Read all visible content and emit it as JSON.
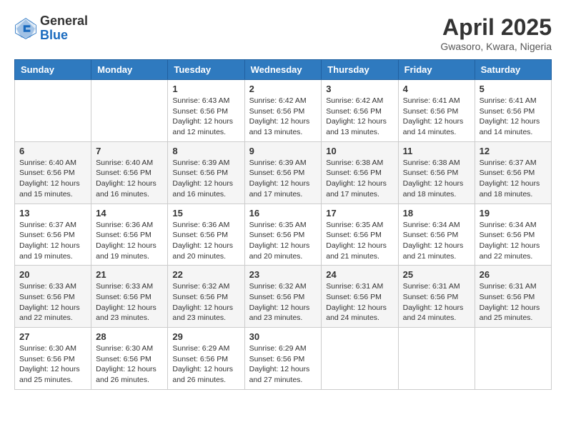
{
  "logo": {
    "general": "General",
    "blue": "Blue"
  },
  "header": {
    "title": "April 2025",
    "subtitle": "Gwasoro, Kwara, Nigeria"
  },
  "weekdays": [
    "Sunday",
    "Monday",
    "Tuesday",
    "Wednesday",
    "Thursday",
    "Friday",
    "Saturday"
  ],
  "weeks": [
    [
      {
        "day": "",
        "sunrise": "",
        "sunset": "",
        "daylight": ""
      },
      {
        "day": "",
        "sunrise": "",
        "sunset": "",
        "daylight": ""
      },
      {
        "day": "1",
        "sunrise": "Sunrise: 6:43 AM",
        "sunset": "Sunset: 6:56 PM",
        "daylight": "Daylight: 12 hours and 12 minutes."
      },
      {
        "day": "2",
        "sunrise": "Sunrise: 6:42 AM",
        "sunset": "Sunset: 6:56 PM",
        "daylight": "Daylight: 12 hours and 13 minutes."
      },
      {
        "day": "3",
        "sunrise": "Sunrise: 6:42 AM",
        "sunset": "Sunset: 6:56 PM",
        "daylight": "Daylight: 12 hours and 13 minutes."
      },
      {
        "day": "4",
        "sunrise": "Sunrise: 6:41 AM",
        "sunset": "Sunset: 6:56 PM",
        "daylight": "Daylight: 12 hours and 14 minutes."
      },
      {
        "day": "5",
        "sunrise": "Sunrise: 6:41 AM",
        "sunset": "Sunset: 6:56 PM",
        "daylight": "Daylight: 12 hours and 14 minutes."
      }
    ],
    [
      {
        "day": "6",
        "sunrise": "Sunrise: 6:40 AM",
        "sunset": "Sunset: 6:56 PM",
        "daylight": "Daylight: 12 hours and 15 minutes."
      },
      {
        "day": "7",
        "sunrise": "Sunrise: 6:40 AM",
        "sunset": "Sunset: 6:56 PM",
        "daylight": "Daylight: 12 hours and 16 minutes."
      },
      {
        "day": "8",
        "sunrise": "Sunrise: 6:39 AM",
        "sunset": "Sunset: 6:56 PM",
        "daylight": "Daylight: 12 hours and 16 minutes."
      },
      {
        "day": "9",
        "sunrise": "Sunrise: 6:39 AM",
        "sunset": "Sunset: 6:56 PM",
        "daylight": "Daylight: 12 hours and 17 minutes."
      },
      {
        "day": "10",
        "sunrise": "Sunrise: 6:38 AM",
        "sunset": "Sunset: 6:56 PM",
        "daylight": "Daylight: 12 hours and 17 minutes."
      },
      {
        "day": "11",
        "sunrise": "Sunrise: 6:38 AM",
        "sunset": "Sunset: 6:56 PM",
        "daylight": "Daylight: 12 hours and 18 minutes."
      },
      {
        "day": "12",
        "sunrise": "Sunrise: 6:37 AM",
        "sunset": "Sunset: 6:56 PM",
        "daylight": "Daylight: 12 hours and 18 minutes."
      }
    ],
    [
      {
        "day": "13",
        "sunrise": "Sunrise: 6:37 AM",
        "sunset": "Sunset: 6:56 PM",
        "daylight": "Daylight: 12 hours and 19 minutes."
      },
      {
        "day": "14",
        "sunrise": "Sunrise: 6:36 AM",
        "sunset": "Sunset: 6:56 PM",
        "daylight": "Daylight: 12 hours and 19 minutes."
      },
      {
        "day": "15",
        "sunrise": "Sunrise: 6:36 AM",
        "sunset": "Sunset: 6:56 PM",
        "daylight": "Daylight: 12 hours and 20 minutes."
      },
      {
        "day": "16",
        "sunrise": "Sunrise: 6:35 AM",
        "sunset": "Sunset: 6:56 PM",
        "daylight": "Daylight: 12 hours and 20 minutes."
      },
      {
        "day": "17",
        "sunrise": "Sunrise: 6:35 AM",
        "sunset": "Sunset: 6:56 PM",
        "daylight": "Daylight: 12 hours and 21 minutes."
      },
      {
        "day": "18",
        "sunrise": "Sunrise: 6:34 AM",
        "sunset": "Sunset: 6:56 PM",
        "daylight": "Daylight: 12 hours and 21 minutes."
      },
      {
        "day": "19",
        "sunrise": "Sunrise: 6:34 AM",
        "sunset": "Sunset: 6:56 PM",
        "daylight": "Daylight: 12 hours and 22 minutes."
      }
    ],
    [
      {
        "day": "20",
        "sunrise": "Sunrise: 6:33 AM",
        "sunset": "Sunset: 6:56 PM",
        "daylight": "Daylight: 12 hours and 22 minutes."
      },
      {
        "day": "21",
        "sunrise": "Sunrise: 6:33 AM",
        "sunset": "Sunset: 6:56 PM",
        "daylight": "Daylight: 12 hours and 23 minutes."
      },
      {
        "day": "22",
        "sunrise": "Sunrise: 6:32 AM",
        "sunset": "Sunset: 6:56 PM",
        "daylight": "Daylight: 12 hours and 23 minutes."
      },
      {
        "day": "23",
        "sunrise": "Sunrise: 6:32 AM",
        "sunset": "Sunset: 6:56 PM",
        "daylight": "Daylight: 12 hours and 23 minutes."
      },
      {
        "day": "24",
        "sunrise": "Sunrise: 6:31 AM",
        "sunset": "Sunset: 6:56 PM",
        "daylight": "Daylight: 12 hours and 24 minutes."
      },
      {
        "day": "25",
        "sunrise": "Sunrise: 6:31 AM",
        "sunset": "Sunset: 6:56 PM",
        "daylight": "Daylight: 12 hours and 24 minutes."
      },
      {
        "day": "26",
        "sunrise": "Sunrise: 6:31 AM",
        "sunset": "Sunset: 6:56 PM",
        "daylight": "Daylight: 12 hours and 25 minutes."
      }
    ],
    [
      {
        "day": "27",
        "sunrise": "Sunrise: 6:30 AM",
        "sunset": "Sunset: 6:56 PM",
        "daylight": "Daylight: 12 hours and 25 minutes."
      },
      {
        "day": "28",
        "sunrise": "Sunrise: 6:30 AM",
        "sunset": "Sunset: 6:56 PM",
        "daylight": "Daylight: 12 hours and 26 minutes."
      },
      {
        "day": "29",
        "sunrise": "Sunrise: 6:29 AM",
        "sunset": "Sunset: 6:56 PM",
        "daylight": "Daylight: 12 hours and 26 minutes."
      },
      {
        "day": "30",
        "sunrise": "Sunrise: 6:29 AM",
        "sunset": "Sunset: 6:56 PM",
        "daylight": "Daylight: 12 hours and 27 minutes."
      },
      {
        "day": "",
        "sunrise": "",
        "sunset": "",
        "daylight": ""
      },
      {
        "day": "",
        "sunrise": "",
        "sunset": "",
        "daylight": ""
      },
      {
        "day": "",
        "sunrise": "",
        "sunset": "",
        "daylight": ""
      }
    ]
  ]
}
